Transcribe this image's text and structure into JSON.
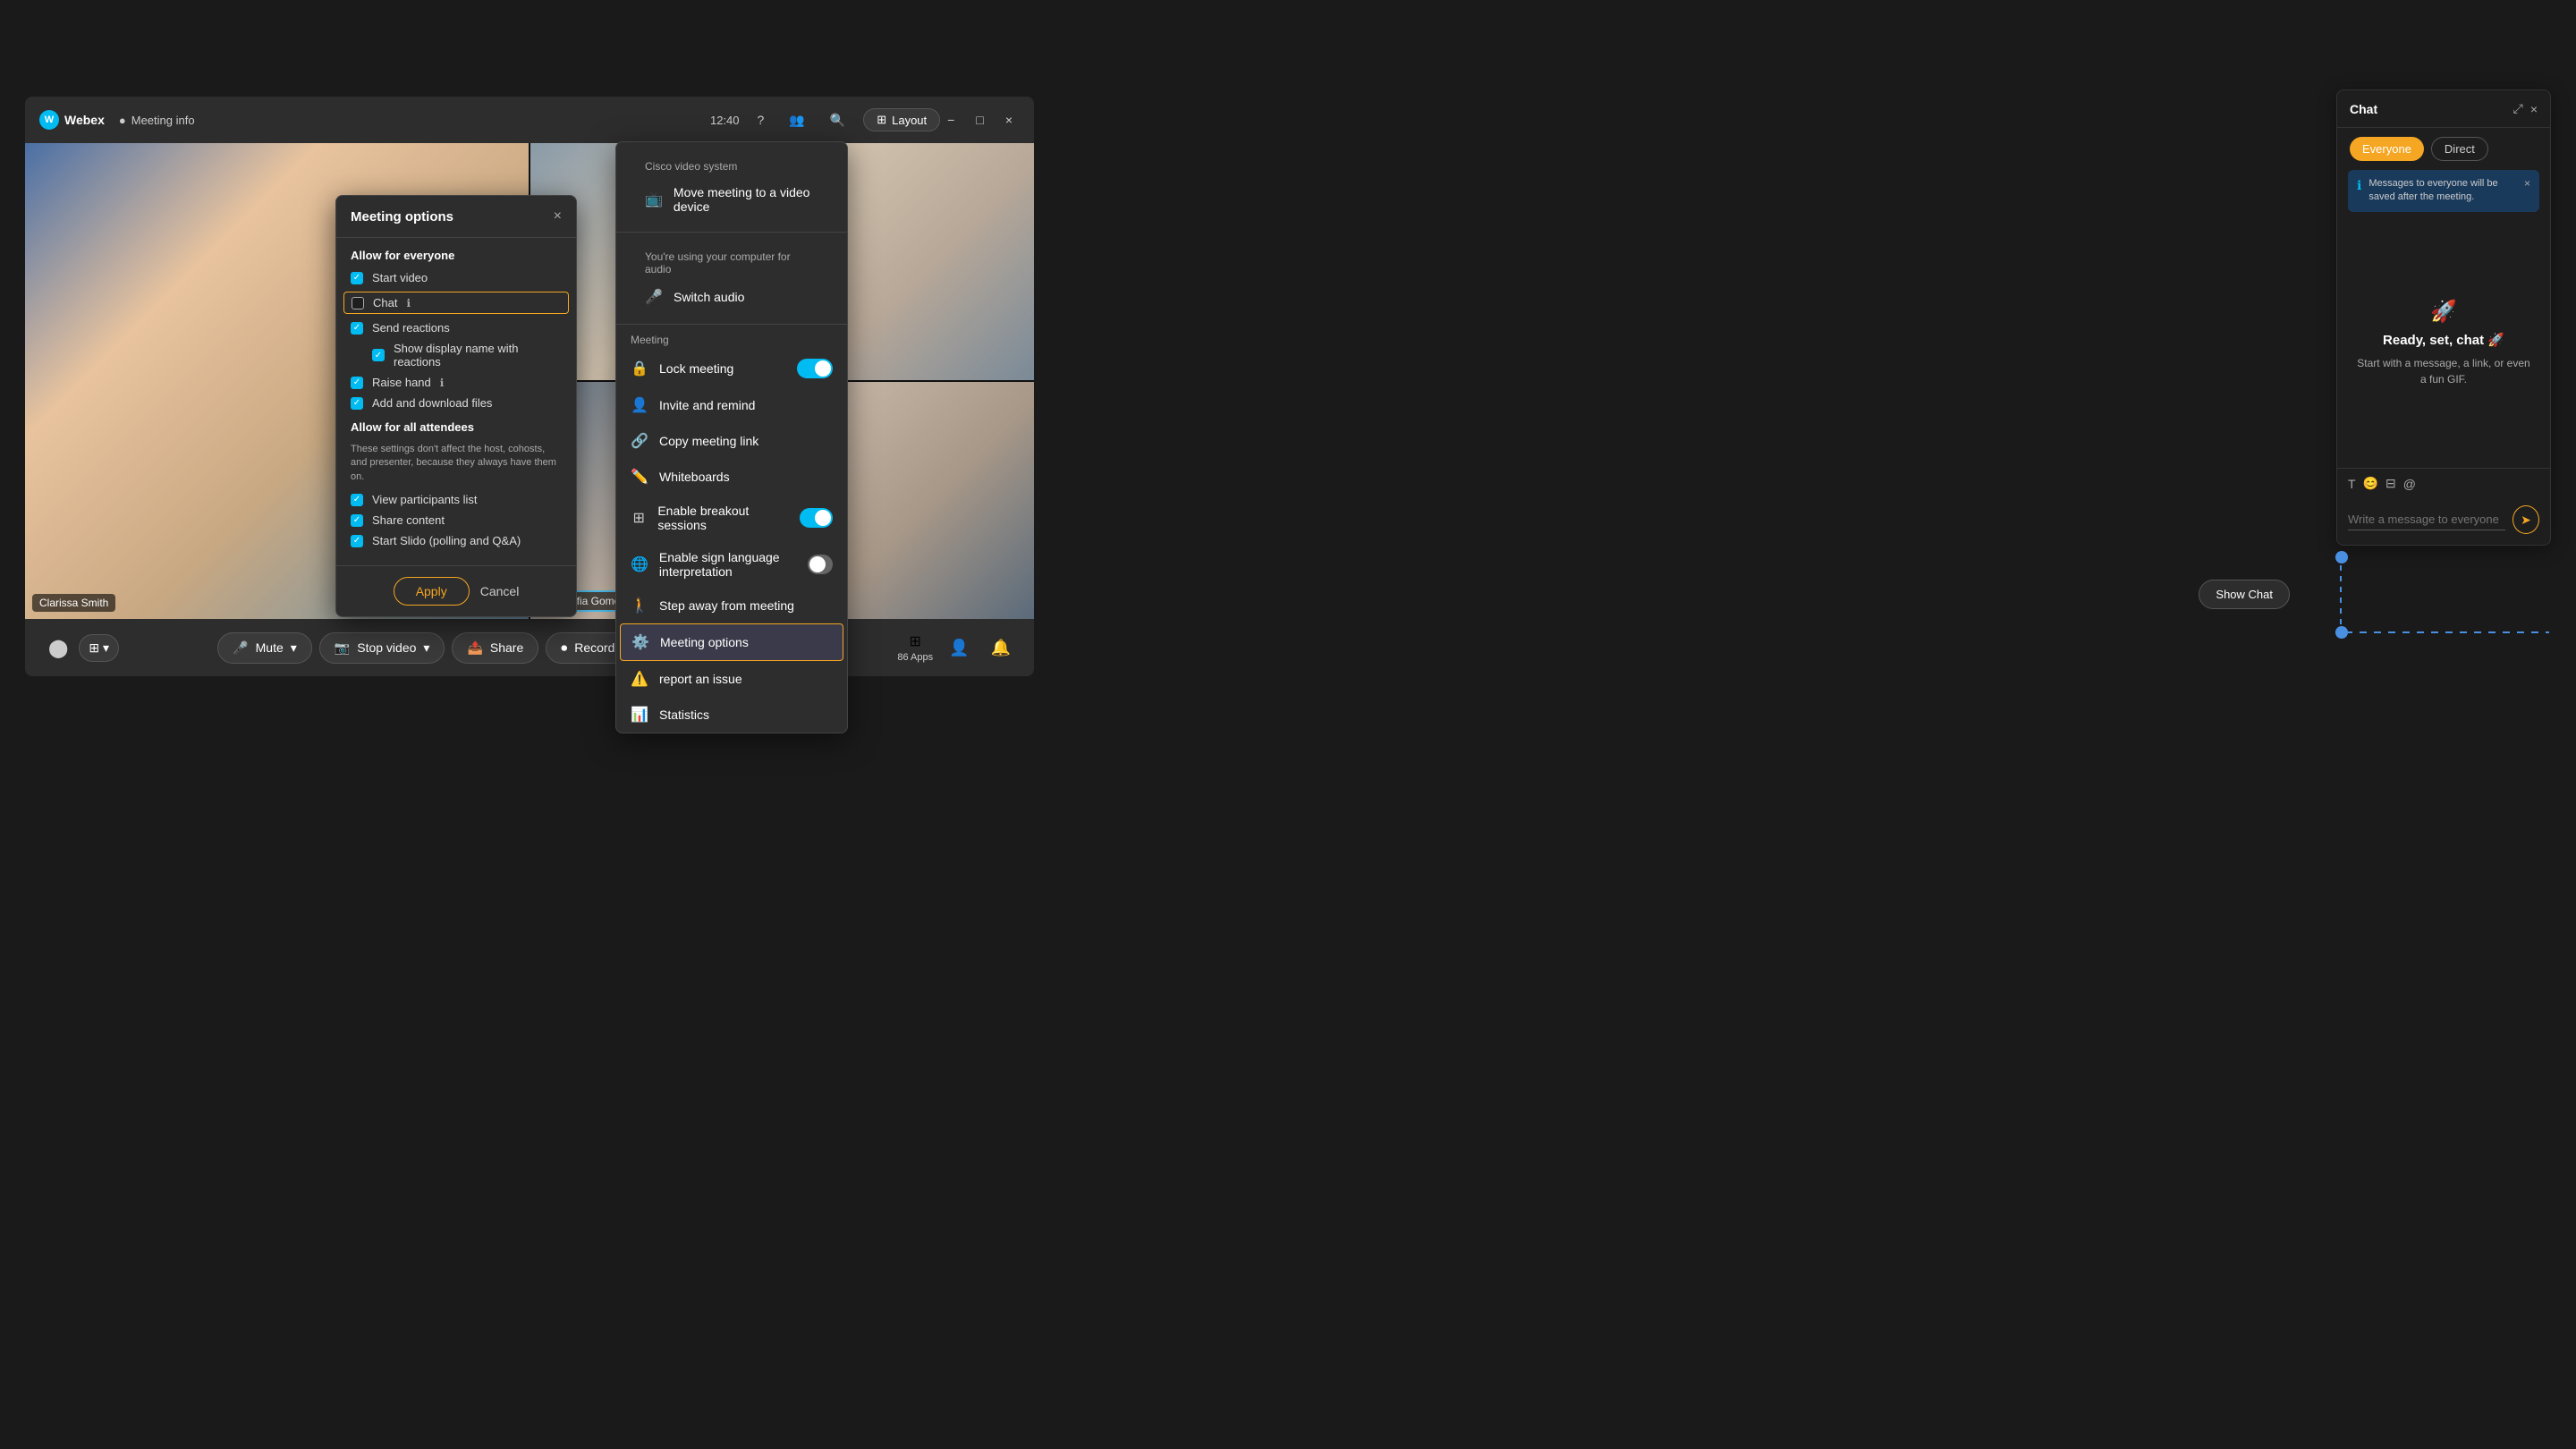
{
  "app": {
    "background_color": "#1a1a1a"
  },
  "title_bar": {
    "webex_label": "Webex",
    "meeting_info_label": "Meeting info",
    "time": "12:40",
    "layout_label": "Layout",
    "minimize_label": "−",
    "maximize_label": "□",
    "close_label": "×"
  },
  "participants": [
    {
      "name": "Clarissa Smith",
      "position": "top-left",
      "has_mic": false
    },
    {
      "name": "",
      "position": "top-right",
      "has_mic": false
    },
    {
      "name": "Sofia Gomez",
      "position": "bottom-right",
      "has_mic": true
    }
  ],
  "toolbar": {
    "mute_label": "Mute",
    "stop_video_label": "Stop video",
    "share_label": "Share",
    "record_label": "Record",
    "more_label": "···",
    "apps_label": "Apps",
    "apps_count": "86 Apps",
    "show_chat_label": "Show Chat",
    "end_label": "✕"
  },
  "context_menu": {
    "cisco_section": "Cisco video system",
    "move_meeting": "Move meeting to a video device",
    "audio_section": "You're using your computer for audio",
    "switch_audio": "Switch audio",
    "meeting_section": "Meeting",
    "lock_meeting": "Lock meeting",
    "lock_meeting_on": true,
    "invite_remind": "Invite and remind",
    "copy_link": "Copy meeting link",
    "whiteboards": "Whiteboards",
    "breakout_sessions": "Enable breakout sessions",
    "breakout_on": true,
    "sign_language": "Enable sign language interpretation",
    "sign_language_on": false,
    "step_away": "Step away from meeting",
    "meeting_options": "Meeting options",
    "report_issue": "report an issue",
    "statistics": "Statistics"
  },
  "meeting_options_modal": {
    "title": "Meeting options",
    "close_label": "×",
    "allow_for_everyone_label": "Allow for everyone",
    "start_video_label": "Start video",
    "start_video_checked": true,
    "chat_label": "Chat",
    "chat_checked": false,
    "send_reactions_label": "Send reactions",
    "send_reactions_checked": true,
    "show_display_name_label": "Show display name with reactions",
    "show_display_name_checked": true,
    "raise_hand_label": "Raise hand",
    "raise_hand_checked": true,
    "add_files_label": "Add and download files",
    "add_files_checked": true,
    "allow_all_attendees_label": "Allow for all attendees",
    "attendees_desc": "These settings don't affect the host, cohosts, and presenter, because they always have them on.",
    "view_participants_label": "View participants list",
    "view_participants_checked": true,
    "share_content_label": "Share content",
    "share_content_checked": true,
    "start_slido_label": "Start Slido (polling and Q&A)",
    "start_slido_checked": true,
    "apply_label": "Apply",
    "cancel_label": "Cancel"
  },
  "chat_panel": {
    "title": "Chat",
    "everyone_tab": "Everyone",
    "direct_tab": "Direct",
    "notice_text": "Messages to everyone will be saved after the meeting.",
    "ready_title": "Ready, set, chat",
    "ready_emoji": "🚀",
    "ready_desc": "Start with a message, a link, or even a fun GIF.",
    "input_placeholder": "Write a message to everyone",
    "send_icon": "➤",
    "toolbar_icons": [
      "T",
      "😊",
      "⊟",
      "@"
    ]
  }
}
